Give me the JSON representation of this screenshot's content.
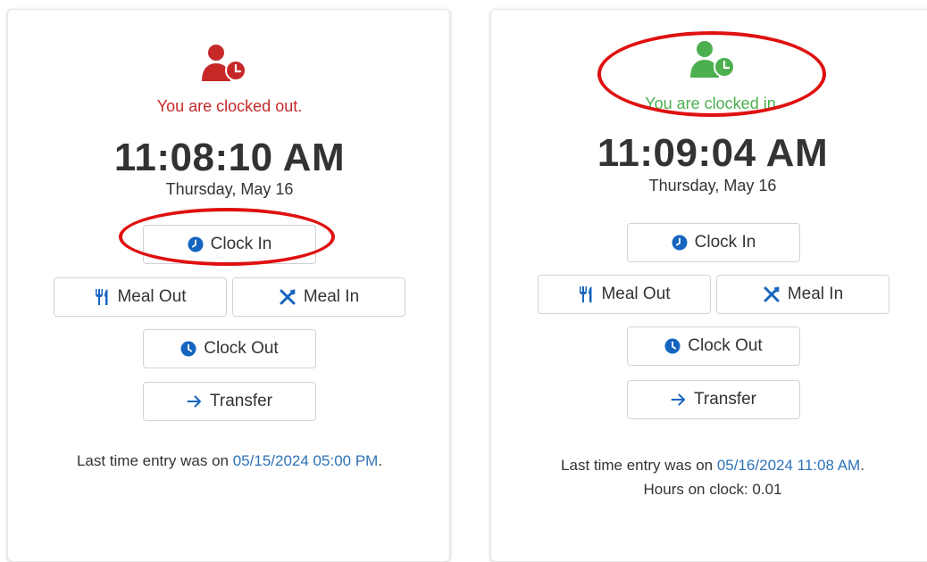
{
  "colors": {
    "clocked_out": "#c62828",
    "clocked_in": "#4caf50",
    "icon_blue": "#1565c0",
    "link_blue": "#2e73b8",
    "highlight_ring": "#e01010"
  },
  "panels": [
    {
      "state": "clocked-out",
      "avatar_icon": "user-clock-icon",
      "status_text": "You are clocked out.",
      "time": "11:08:10 AM",
      "date": "Thursday, May 16",
      "buttons": {
        "clock_in": {
          "label": "Clock In",
          "icon": "clock-icon"
        },
        "meal_out": {
          "label": "Meal Out",
          "icon": "utensils-icon"
        },
        "meal_in": {
          "label": "Meal In",
          "icon": "crossed-utensils-icon"
        },
        "clock_out": {
          "label": "Clock Out",
          "icon": "clock-icon"
        },
        "transfer": {
          "label": "Transfer",
          "icon": "arrow-right-icon"
        }
      },
      "last_entry_prefix": "Last time entry was on ",
      "last_entry_value": "05/15/2024 05:00 PM",
      "last_entry_suffix": ".",
      "hours_on_clock": ""
    },
    {
      "state": "clocked-in",
      "avatar_icon": "user-clock-icon",
      "status_text": "You are clocked in.",
      "time": "11:09:04 AM",
      "date": "Thursday, May 16",
      "buttons": {
        "clock_in": {
          "label": "Clock In",
          "icon": "clock-icon"
        },
        "meal_out": {
          "label": "Meal Out",
          "icon": "utensils-icon"
        },
        "meal_in": {
          "label": "Meal In",
          "icon": "crossed-utensils-icon"
        },
        "clock_out": {
          "label": "Clock Out",
          "icon": "clock-icon"
        },
        "transfer": {
          "label": "Transfer",
          "icon": "arrow-right-icon"
        }
      },
      "last_entry_prefix": "Last time entry was on ",
      "last_entry_value": "05/16/2024 11:08 AM",
      "last_entry_suffix": ".",
      "hours_on_clock": "Hours on clock: 0.01"
    }
  ]
}
